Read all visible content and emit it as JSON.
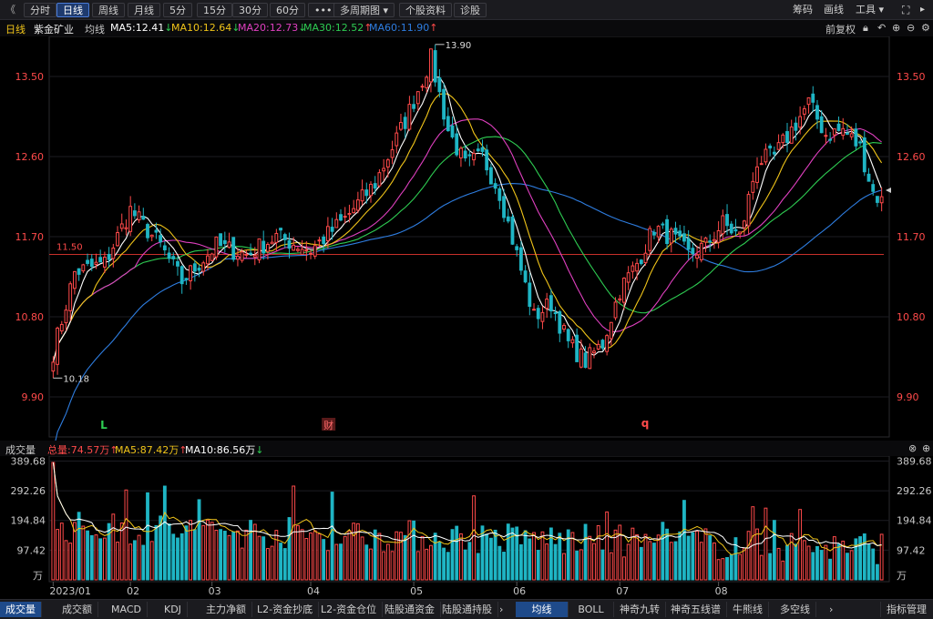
{
  "toolbar": {
    "back": "《",
    "tabs": [
      "分时",
      "日线",
      "周线",
      "月线",
      "5分",
      "15分",
      "30分",
      "60分"
    ],
    "active_tab": "日线",
    "more": "•••",
    "multi_period": "多周期图",
    "stock_info": "个股资料",
    "diagnose": "诊股",
    "right_items": [
      "筹码",
      "画线",
      "工具"
    ]
  },
  "info": {
    "period": "日线",
    "stock_name": "紫金矿业",
    "avg_line": "均线",
    "ma5": "MA5:12.41",
    "ma10": "MA10:12.64",
    "ma20": "MA20:12.73",
    "ma30": "MA30:12.52",
    "ma60": "MA60:11.90",
    "adjust": "前复权"
  },
  "price_axis": {
    "ticks": [
      "13.50",
      "12.60",
      "11.70",
      "10.80",
      "9.90"
    ],
    "tick_values": [
      13.5,
      12.6,
      11.7,
      10.8,
      9.9
    ],
    "ref_line_label": "11.50",
    "ref_line_value": 11.5,
    "high_label": "13.90",
    "low_label": "10.18",
    "markers": [
      "L",
      "财",
      "q"
    ]
  },
  "volume": {
    "title": "成交量",
    "total": "总量:74.57万",
    "ma5": "MA5:87.42万",
    "ma10": "MA10:86.56万",
    "ticks": [
      "389.68",
      "292.26",
      "194.84",
      "97.42"
    ],
    "unit": "万"
  },
  "xaxis": {
    "labels": [
      "2023/01",
      "02",
      "03",
      "04",
      "05",
      "06",
      "07",
      "08"
    ]
  },
  "bottom_tabs": [
    "成交量",
    "成交额",
    "MACD",
    "KDJ",
    "主力净额",
    "L2-资金抄底",
    "L2-资金仓位",
    "陆股通资金",
    "陆股通持股"
  ],
  "bottom_right_tabs": [
    "均线",
    "BOLL",
    "神奇九转",
    "神奇五线谱",
    "牛熊线",
    "多空线"
  ],
  "bottom_manage": "指标管理",
  "colors": {
    "up": "#ff4a4a",
    "down": "#1fb5c4",
    "ma5": "#ffffff",
    "ma10": "#f0c419",
    "ma20": "#e040c0",
    "ma30": "#2ecc52",
    "ma60": "#2e7de0"
  },
  "chart_data": {
    "type": "candlestick",
    "x_range": [
      "2023/01",
      "08"
    ],
    "y_range": [
      9.45,
      13.95
    ],
    "reference_line": 11.5,
    "keypoints": [
      {
        "i": 0,
        "c": 10.4
      },
      {
        "i": 5,
        "c": 11.3
      },
      {
        "i": 12,
        "c": 11.4
      },
      {
        "i": 18,
        "c": 12.0
      },
      {
        "i": 25,
        "c": 11.6
      },
      {
        "i": 30,
        "c": 11.2
      },
      {
        "i": 38,
        "c": 11.6
      },
      {
        "i": 45,
        "c": 11.5
      },
      {
        "i": 52,
        "c": 11.7
      },
      {
        "i": 60,
        "c": 11.55
      },
      {
        "i": 68,
        "c": 11.9
      },
      {
        "i": 75,
        "c": 12.3
      },
      {
        "i": 82,
        "c": 13.0
      },
      {
        "i": 88,
        "c": 13.7
      },
      {
        "i": 92,
        "c": 12.9
      },
      {
        "i": 96,
        "c": 12.5
      },
      {
        "i": 100,
        "c": 12.6
      },
      {
        "i": 104,
        "c": 12.2
      },
      {
        "i": 108,
        "c": 11.5
      },
      {
        "i": 112,
        "c": 10.8
      },
      {
        "i": 116,
        "c": 10.95
      },
      {
        "i": 120,
        "c": 10.5
      },
      {
        "i": 124,
        "c": 10.3
      },
      {
        "i": 128,
        "c": 10.5
      },
      {
        "i": 132,
        "c": 11.1
      },
      {
        "i": 136,
        "c": 11.4
      },
      {
        "i": 140,
        "c": 11.8
      },
      {
        "i": 144,
        "c": 11.7
      },
      {
        "i": 148,
        "c": 11.5
      },
      {
        "i": 152,
        "c": 11.6
      },
      {
        "i": 156,
        "c": 11.85
      },
      {
        "i": 160,
        "c": 11.7
      },
      {
        "i": 164,
        "c": 12.55
      },
      {
        "i": 168,
        "c": 12.6
      },
      {
        "i": 172,
        "c": 12.9
      },
      {
        "i": 176,
        "c": 13.2
      },
      {
        "i": 180,
        "c": 12.85
      },
      {
        "i": 184,
        "c": 12.9
      },
      {
        "i": 188,
        "c": 12.7
      },
      {
        "i": 191,
        "c": 12.2
      },
      {
        "i": 193,
        "c": 12.1
      }
    ]
  }
}
